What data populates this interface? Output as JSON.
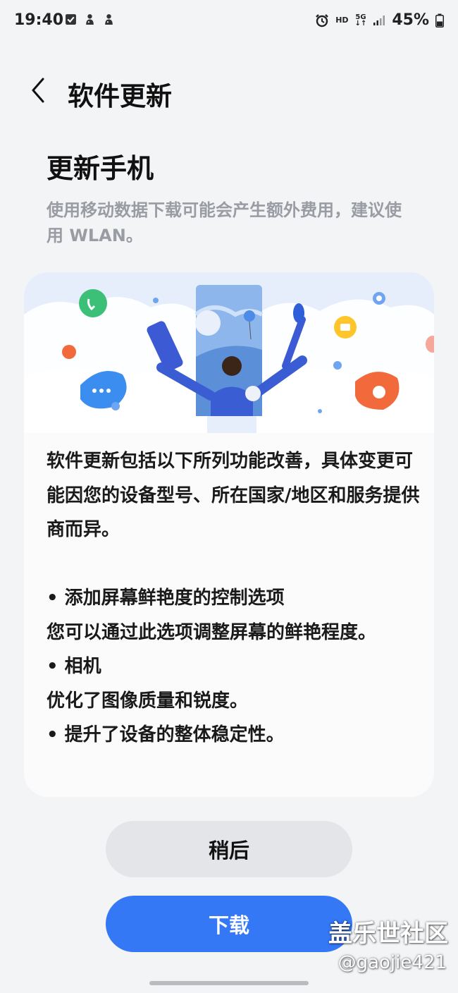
{
  "status_bar": {
    "time": "19:40",
    "left_icons": [
      "check-square-icon",
      "notification-icon",
      "notification-icon"
    ],
    "network": {
      "hd": "HD",
      "five_g": "5G"
    },
    "battery_percent": "45%",
    "battery_level": 0.45
  },
  "header": {
    "title": "软件更新"
  },
  "update": {
    "title": "更新手机",
    "subtitle": "使用移动数据下载可能会产生额外费用，建议使用 WLAN。"
  },
  "card": {
    "intro": "软件更新包括以下所列功能改善，具体变更可能因您的设备型号、所在国家/地区和服务提供商而异。",
    "items": [
      {
        "title": "• 添加屏幕鲜艳度的控制选项",
        "desc": "您可以通过此选项调整屏幕的鲜艳程度。"
      },
      {
        "title": "• 相机",
        "desc": "优化了图像质量和锐度。"
      },
      {
        "title": "• 提升了设备的整体稳定性。",
        "desc": ""
      }
    ]
  },
  "buttons": {
    "later": "稍后",
    "download": "下载"
  },
  "watermark": {
    "brand": "盖乐世社区",
    "user": "@gaojie421"
  },
  "colors": {
    "accent": "#3478f6",
    "background": "#f3f4f6",
    "card": "#fbfbfc",
    "secondary_text": "#9a9ca3"
  }
}
